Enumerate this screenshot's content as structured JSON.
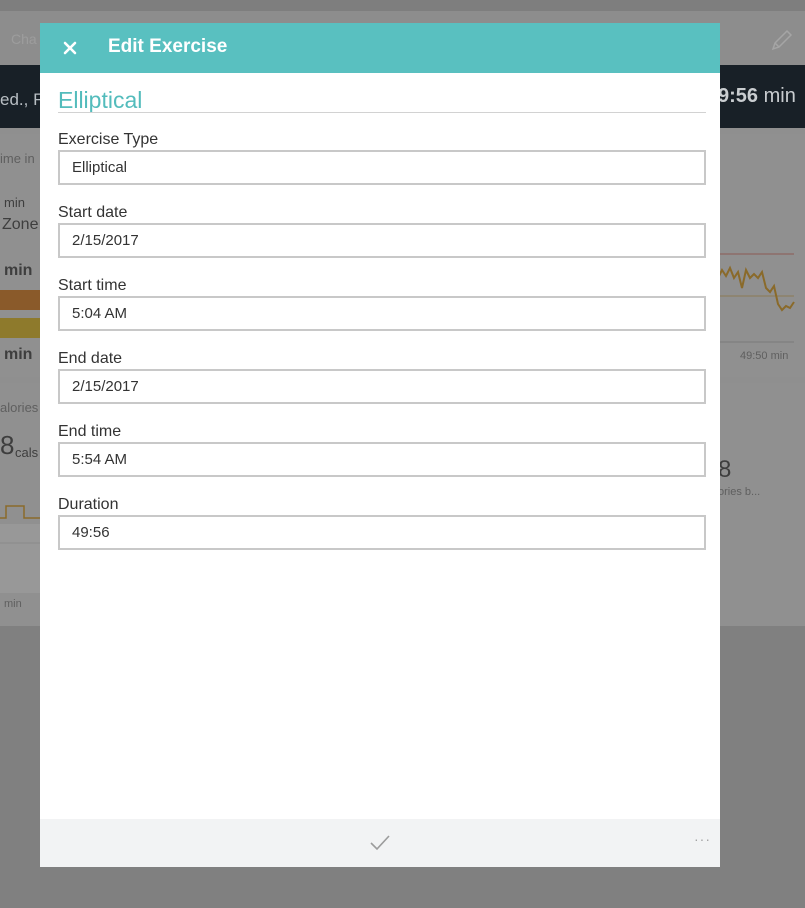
{
  "background": {
    "header_partial": "Cha",
    "summary_left_partial": "ed., F",
    "summary_right_value": "9:56",
    "summary_right_unit": "min",
    "card1": {
      "label_time_in": "ime in",
      "label_min_small": "min",
      "label_zone": "Zone",
      "value_min_1": "min",
      "value_min_2": "min",
      "chart_time_label": "49:50 min"
    },
    "card2": {
      "label_calories": "alories",
      "calories_value": "8",
      "calories_unit": "cals",
      "right_value": "8",
      "right_label": "ories b...",
      "bottom_label": "min"
    }
  },
  "modal": {
    "title": "Edit Exercise",
    "section_title": "Elliptical",
    "fields": {
      "exercise_type": {
        "label": "Exercise Type",
        "value": "Elliptical"
      },
      "start_date": {
        "label": "Start date",
        "value": "2/15/2017"
      },
      "start_time": {
        "label": "Start time",
        "value": "5:04 AM"
      },
      "end_date": {
        "label": "End date",
        "value": "2/15/2017"
      },
      "end_time": {
        "label": "End time",
        "value": "5:54 AM"
      },
      "duration": {
        "label": "Duration",
        "value": "49:56"
      }
    },
    "footer": {
      "more_label": "···"
    }
  },
  "icons": {
    "close": "close-icon",
    "confirm": "checkmark-icon",
    "edit": "pencil-icon"
  },
  "colors": {
    "accent": "#59c0c0",
    "accent_text": "#53bcbc",
    "dark_bar": "#182027",
    "footer_bg": "#f2f3f4"
  }
}
